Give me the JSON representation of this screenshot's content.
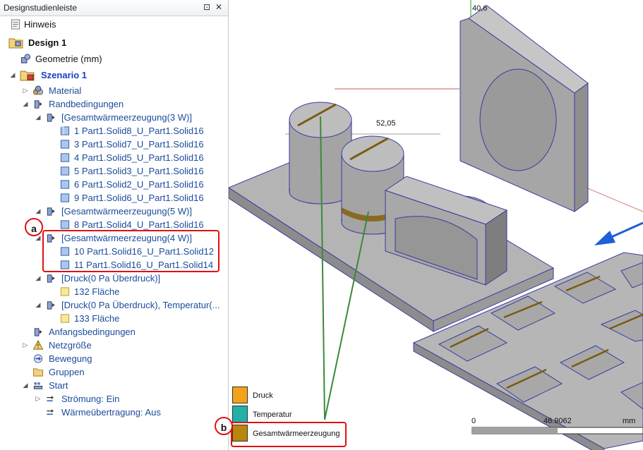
{
  "panel": {
    "title": "Designstudienleiste",
    "pin_glyph": "⊡",
    "close_glyph": "✕"
  },
  "tree": {
    "hinweis": "Hinweis",
    "design": "Design 1",
    "geometrie": "Geometrie (mm)",
    "szenario": "Szenario 1",
    "material": "Material",
    "randbedingungen": "Randbedingungen",
    "gw3": "[Gesamtwärmeerzeugung(3 W)]",
    "gw3_items": [
      "1 Part1.Solid8_U_Part1.Solid16",
      "3 Part1.Solid7_U_Part1.Solid16",
      "4 Part1.Solid5_U_Part1.Solid16",
      "5 Part1.Solid3_U_Part1.Solid16",
      "6 Part1.Solid2_U_Part1.Solid16",
      "9 Part1.Solid6_U_Part1.Solid16"
    ],
    "gw5": "[Gesamtwärmeerzeugung(5 W)]",
    "gw5_items": [
      "8 Part1.Solid4_U_Part1.Solid16"
    ],
    "gw4": "[Gesamtwärmeerzeugung(4 W)]",
    "gw4_items": [
      "10 Part1.Solid16_U_Part1.Solid12",
      "11 Part1.Solid16_U_Part1.Solid14"
    ],
    "druck": "[Druck(0 Pa Überdruck)]",
    "druck_item": "132 Fläche",
    "druck_temp": "[Druck(0 Pa Überdruck), Temperatur(...",
    "druck_temp_item": "133 Fläche",
    "anfangsbedingungen": "Anfangsbedingungen",
    "netzgroesse": "Netzgröße",
    "bewegung": "Bewegung",
    "gruppen": "Gruppen",
    "start": "Start",
    "stroemung": "Strömung: Ein",
    "waermeuebertragung": "Wärmeübertragung: Aus"
  },
  "callouts": {
    "a": "a",
    "b": "b",
    "color": "#e01010"
  },
  "viewport": {
    "dim_top": "40,6",
    "dim_mid": "52,05",
    "scale_start": "0",
    "scale_mid": "46.9062",
    "scale_unit": "mm"
  },
  "legend": [
    {
      "label": "Druck",
      "color": "#f5a21b"
    },
    {
      "label": "Temperatur",
      "color": "#22b0a8"
    },
    {
      "label": "Gesamtwärmeerzeugung",
      "color": "#b8860b"
    }
  ],
  "colors": {
    "link_blue": "#1a4b9c",
    "szenario_blue": "#1a3fbf",
    "model_gray": "#a8a8a8",
    "load_line": "#3a8a3a",
    "arrow_blue": "#1f5fd8"
  }
}
